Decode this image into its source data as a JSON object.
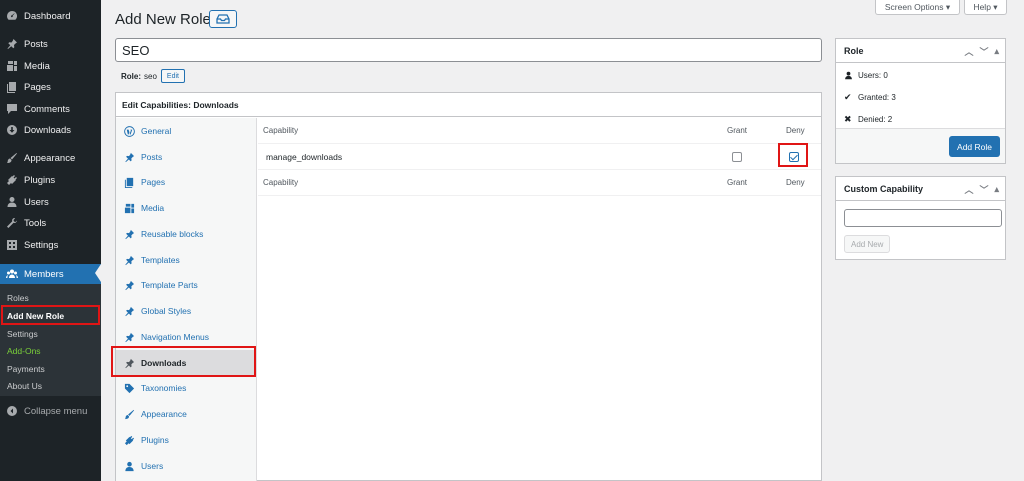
{
  "menu": {
    "items": [
      {
        "label": "Dashboard",
        "icon": "dashboard-icon"
      },
      {
        "label": "Posts",
        "icon": "pin-icon"
      },
      {
        "label": "Media",
        "icon": "media-icon"
      },
      {
        "label": "Pages",
        "icon": "pages-icon"
      },
      {
        "label": "Comments",
        "icon": "comments-icon"
      },
      {
        "label": "Downloads",
        "icon": "download-icon"
      },
      {
        "label": "Appearance",
        "icon": "brush-icon"
      },
      {
        "label": "Plugins",
        "icon": "plugin-icon"
      },
      {
        "label": "Users",
        "icon": "users-icon"
      },
      {
        "label": "Tools",
        "icon": "wrench-icon"
      },
      {
        "label": "Settings",
        "icon": "settings-icon"
      },
      {
        "label": "Members",
        "icon": "groups-icon"
      }
    ],
    "submenu": [
      "Roles",
      "Add New Role",
      "Settings",
      "Add-Ons",
      "Payments",
      "About Us"
    ],
    "collapse": "Collapse menu"
  },
  "header": {
    "title": "Add New Role",
    "screen_options": "Screen Options ▾",
    "help": "Help ▾"
  },
  "role": {
    "name": "SEO",
    "slug_label": "Role:",
    "slug_value": "seo",
    "edit_label": "Edit"
  },
  "capabilities": {
    "heading": "Edit Capabilities: Downloads",
    "tabs": [
      {
        "label": "General",
        "icon": "wordpress-icon"
      },
      {
        "label": "Posts",
        "icon": "pin-icon"
      },
      {
        "label": "Pages",
        "icon": "pages-icon"
      },
      {
        "label": "Media",
        "icon": "media-icon"
      },
      {
        "label": "Reusable blocks",
        "icon": "pin-icon"
      },
      {
        "label": "Templates",
        "icon": "pin-icon"
      },
      {
        "label": "Template Parts",
        "icon": "pin-icon"
      },
      {
        "label": "Global Styles",
        "icon": "pin-icon"
      },
      {
        "label": "Navigation Menus",
        "icon": "pin-icon"
      },
      {
        "label": "Downloads",
        "icon": "pin-icon"
      },
      {
        "label": "Taxonomies",
        "icon": "tag-icon"
      },
      {
        "label": "Appearance",
        "icon": "brush-icon"
      },
      {
        "label": "Plugins",
        "icon": "plugin-icon"
      },
      {
        "label": "Users",
        "icon": "users-icon"
      }
    ],
    "columns": {
      "capability": "Capability",
      "grant": "Grant",
      "deny": "Deny"
    },
    "rows": [
      {
        "name": "manage_downloads",
        "grant": false,
        "deny": true
      }
    ]
  },
  "role_box": {
    "title": "Role",
    "users": "Users: 0",
    "granted": "Granted: 3",
    "denied": "Denied: 2",
    "button": "Add Role"
  },
  "custom_cap_box": {
    "title": "Custom Capability",
    "input_value": "",
    "button": "Add New"
  },
  "colors": {
    "sidebar": "#1d2327",
    "accent": "#2271b1",
    "highlight": "#e01515",
    "addon": "#7ad03a"
  }
}
